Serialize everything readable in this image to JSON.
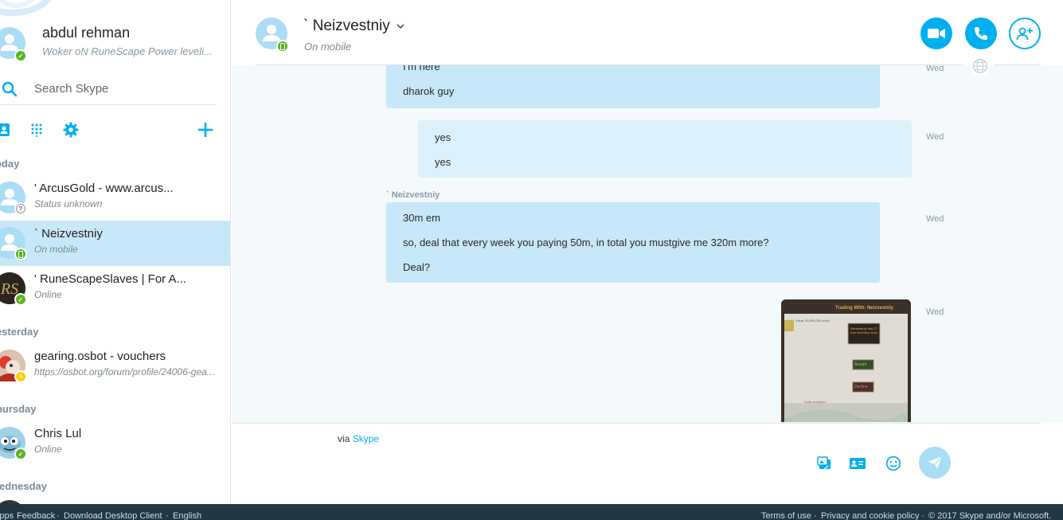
{
  "profile": {
    "name": "abdul rehman",
    "mood": "Woker oN RuneScape Power leveli..."
  },
  "search": {
    "placeholder": "Search Skype"
  },
  "sections": {
    "today": "Today",
    "yesterday": "Yesterday",
    "thursday": "Thursday",
    "wednesday": "Wednesday"
  },
  "contacts": [
    {
      "name": "' ArcusGold - www.arcus...",
      "status": "Status unknown",
      "presence": "unknown"
    },
    {
      "name": "` Neizvestniy",
      "status": "On mobile",
      "presence": "mobile",
      "active": true
    },
    {
      "name": "' RuneScapeSlaves | For A...",
      "status": "Online",
      "presence": "online"
    },
    {
      "name": "gearing.osbot - vouchers",
      "status": "https://osbot.org/forum/profile/24006-gea...",
      "presence": "away"
    },
    {
      "name": "Chris Lul",
      "status": "Online",
      "presence": "online"
    }
  ],
  "chat": {
    "title": "` Neizvestniy",
    "subtitle": "On mobile",
    "sender": "` Neizvestniy",
    "time_label": "Wed",
    "messages": [
      {
        "lines": [
          "I'm here",
          "dharok guy"
        ],
        "mine": false
      },
      {
        "lines": [
          "yes",
          "yes"
        ],
        "mine": true
      },
      {
        "lines": [
          "30m em",
          "so, deal that every week you paying 50m, in total you mustgive me 320m more?",
          "Deal?"
        ],
        "mine": false
      }
    ],
    "image": {
      "title": "Trading With: Neizvestniy",
      "value_label": "Value: 30,000,000 coins",
      "notice": "Neizvestniy has 27 free inventory slots",
      "accept": "Accept",
      "decline": "Decline",
      "footer": "Trade accepted"
    }
  },
  "compose": {
    "via_prefix": "via",
    "via_link": "Skype"
  },
  "footer": {
    "left": [
      "Apps",
      "Feedback",
      "Download Desktop Client",
      "English"
    ],
    "right": [
      "Terms of use",
      "Privacy and cookie policy",
      "© 2017 Skype and/or Microsoft."
    ]
  },
  "colors": {
    "accent": "#00aff0",
    "bubble_other": "#c6e8f9",
    "bubble_mine": "#dbf0fb",
    "online": "#5bb323",
    "away": "#fcd116",
    "footer": "#233743"
  }
}
